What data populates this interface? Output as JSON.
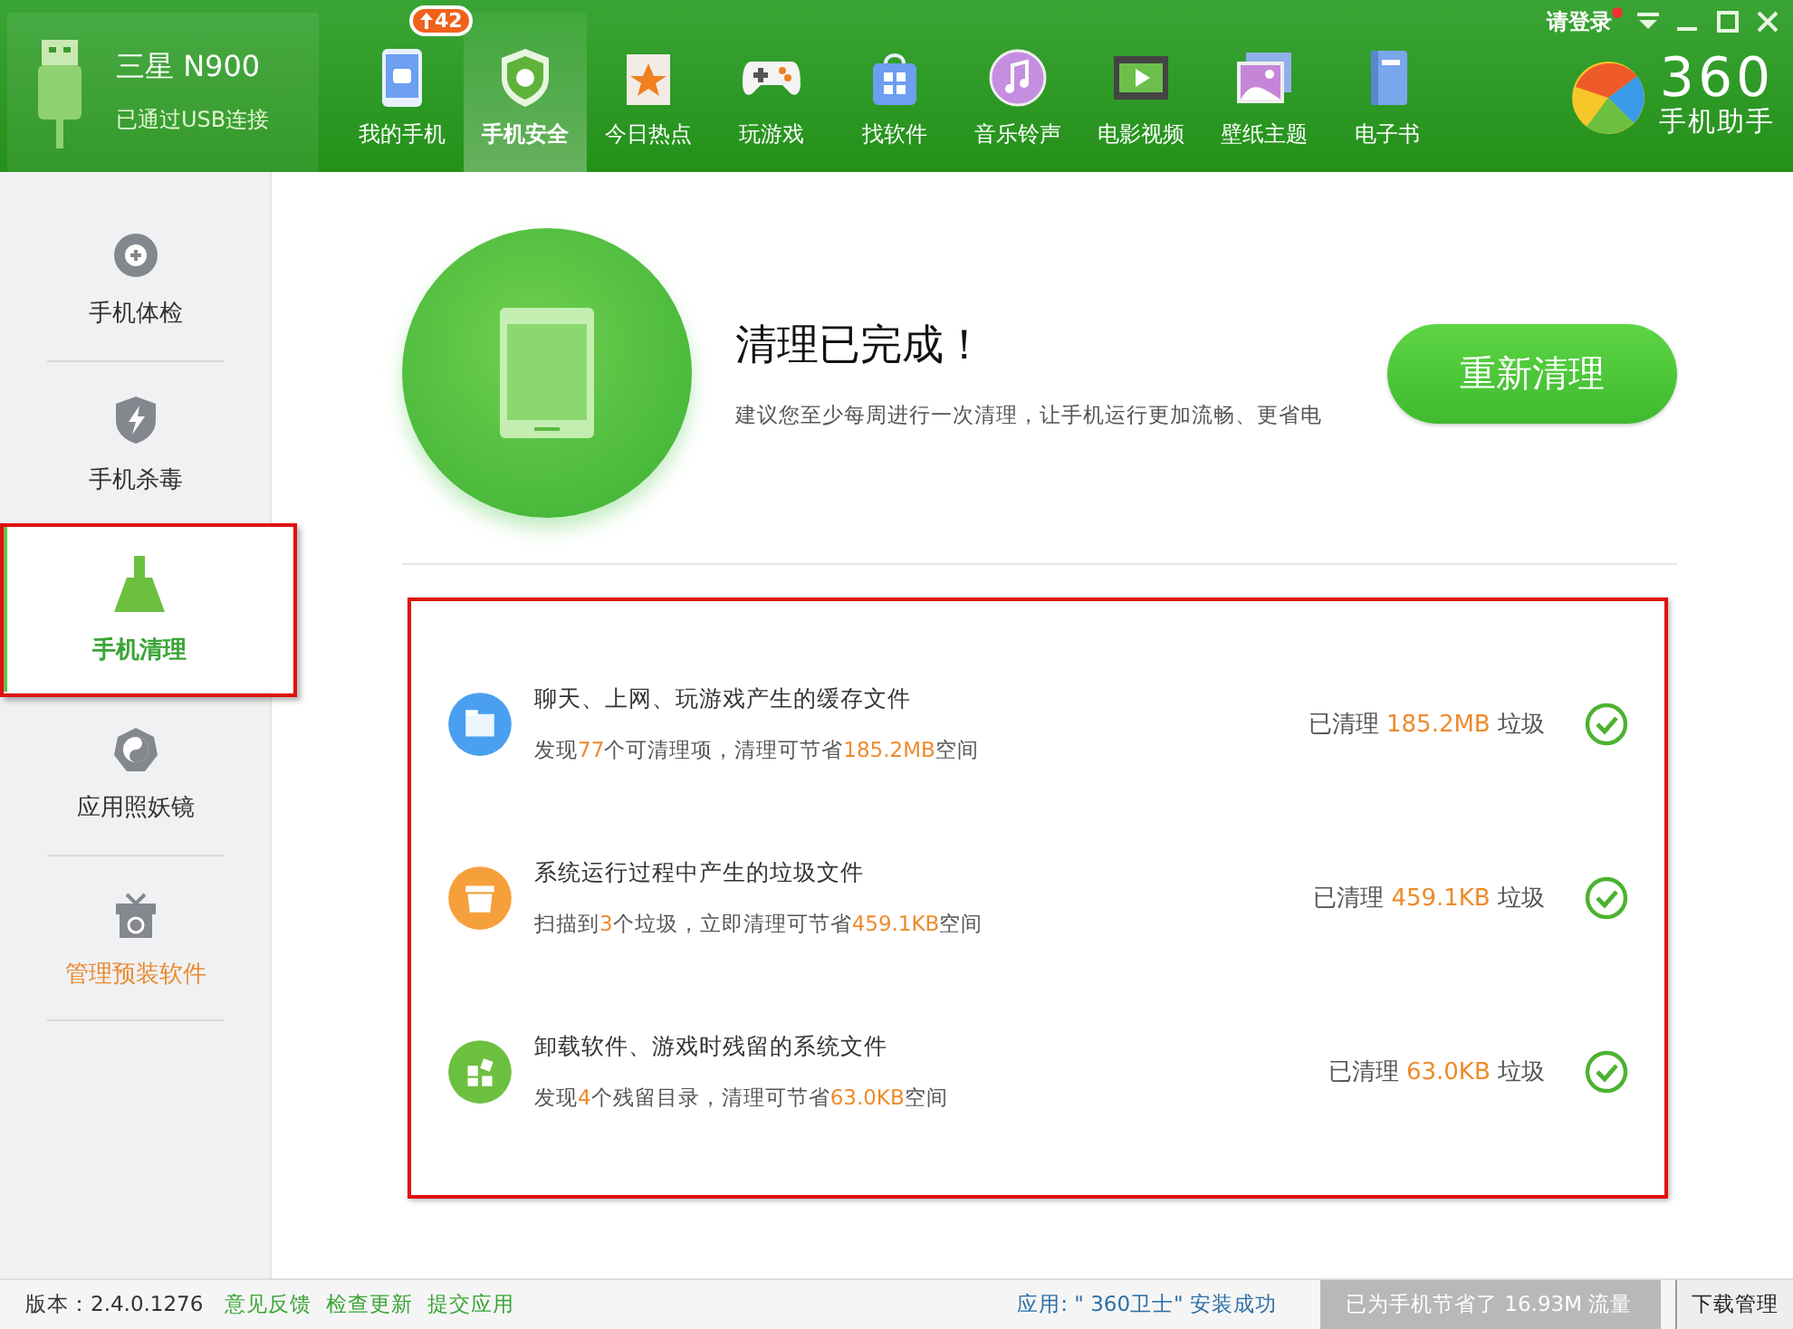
{
  "device": {
    "name": "三星 N900",
    "connection": "已通过USB连接"
  },
  "tabs": [
    {
      "label": "我的手机",
      "selected": false,
      "badge": "42"
    },
    {
      "label": "手机安全",
      "selected": true
    },
    {
      "label": "今日热点",
      "selected": false
    },
    {
      "label": "玩游戏",
      "selected": false
    },
    {
      "label": "找软件",
      "selected": false
    },
    {
      "label": "音乐铃声",
      "selected": false
    },
    {
      "label": "电影视频",
      "selected": false
    },
    {
      "label": "壁纸主题",
      "selected": false
    },
    {
      "label": "电子书",
      "selected": false
    }
  ],
  "login": {
    "label": "请登录",
    "notification": true
  },
  "logo": {
    "number": "360",
    "subtitle": "手机助手"
  },
  "sidebar": {
    "items": [
      {
        "label": "手机体检",
        "selected": false,
        "kind": "normal",
        "annotated": false
      },
      {
        "label": "手机杀毒",
        "selected": false,
        "kind": "normal",
        "annotated": false
      },
      {
        "label": "手机清理",
        "selected": true,
        "kind": "normal",
        "annotated": true
      },
      {
        "label": "应用照妖镜",
        "selected": false,
        "kind": "normal",
        "annotated": false
      },
      {
        "label": "管理预装软件",
        "selected": false,
        "kind": "featured",
        "annotated": false
      }
    ]
  },
  "result": {
    "title": "清理已完成！",
    "hint": "建议您至少每周进行一次清理，让手机运行更加流畅、更省电",
    "button": "重新清理"
  },
  "clean_list": {
    "annotated": true,
    "rows": [
      {
        "title": "聊天、上网、玩游戏产生的缓存文件",
        "detail": [
          {
            "text": "发现",
            "accent": false
          },
          {
            "text": "77",
            "accent": true
          },
          {
            "text": "个可清理项，清理可节省",
            "accent": false
          },
          {
            "text": "185.2MB",
            "accent": true
          },
          {
            "text": "空间",
            "accent": false
          }
        ],
        "result": [
          {
            "text": "已清理 ",
            "accent": false
          },
          {
            "text": "185.2MB",
            "accent": true
          },
          {
            "text": " 垃圾",
            "accent": false
          }
        ],
        "done": true
      },
      {
        "title": "系统运行过程中产生的垃圾文件",
        "detail": [
          {
            "text": "扫描到",
            "accent": false
          },
          {
            "text": "3",
            "accent": true
          },
          {
            "text": "个垃圾，立即清理可节省",
            "accent": false
          },
          {
            "text": "459.1KB",
            "accent": true
          },
          {
            "text": "空间",
            "accent": false
          }
        ],
        "result": [
          {
            "text": "已清理 ",
            "accent": false
          },
          {
            "text": "459.1KB",
            "accent": true
          },
          {
            "text": " 垃圾",
            "accent": false
          }
        ],
        "done": true
      },
      {
        "title": "卸载软件、游戏时残留的系统文件",
        "detail": [
          {
            "text": "发现",
            "accent": false
          },
          {
            "text": "4",
            "accent": true
          },
          {
            "text": "个残留目录，清理可节省",
            "accent": false
          },
          {
            "text": "63.0KB",
            "accent": true
          },
          {
            "text": "空间",
            "accent": false
          }
        ],
        "result": [
          {
            "text": "已清理 ",
            "accent": false
          },
          {
            "text": "63.0KB",
            "accent": true
          },
          {
            "text": " 垃圾",
            "accent": false
          }
        ],
        "done": true
      }
    ]
  },
  "status_bar": {
    "version": "版本：2.4.0.1276",
    "links": [
      "意见反馈",
      "检查更新",
      "提交应用"
    ],
    "notice": "应用: \" 360卫士\" 安装成功",
    "saved": "已为手机节省了 16.93M 流量",
    "download": "下载管理"
  }
}
